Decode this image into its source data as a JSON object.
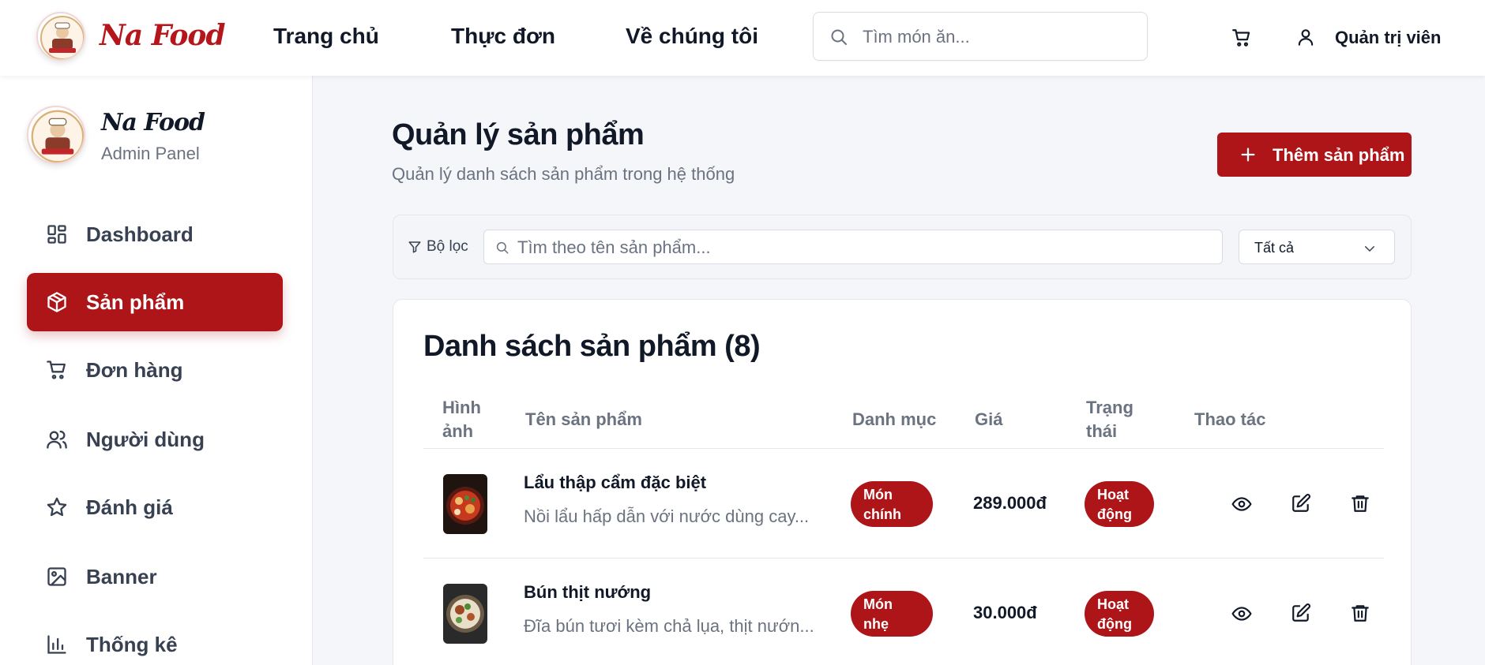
{
  "header": {
    "brand": "Na Food",
    "nav": [
      "Trang chủ",
      "Thực đơn",
      "Về chúng tôi"
    ],
    "search_placeholder": "Tìm món ăn...",
    "user_label": "Quản trị viên"
  },
  "sidebar": {
    "brand": "Na Food",
    "subtitle": "Admin Panel",
    "items": [
      {
        "label": "Dashboard",
        "icon": "dashboard-icon",
        "active": false
      },
      {
        "label": "Sản phẩm",
        "icon": "box-icon",
        "active": true
      },
      {
        "label": "Đơn hàng",
        "icon": "cart-icon",
        "active": false
      },
      {
        "label": "Người dùng",
        "icon": "users-icon",
        "active": false
      },
      {
        "label": "Đánh giá",
        "icon": "star-icon",
        "active": false
      },
      {
        "label": "Banner",
        "icon": "image-icon",
        "active": false
      },
      {
        "label": "Thống kê",
        "icon": "bar-chart-icon",
        "active": false
      }
    ]
  },
  "page": {
    "title": "Quản lý sản phẩm",
    "subtitle": "Quản lý danh sách sản phẩm trong hệ thống",
    "add_button": "Thêm sản phẩm"
  },
  "filter": {
    "label": "Bộ lọc",
    "search_placeholder": "Tìm theo tên sản phẩm...",
    "select_value": "Tất cả"
  },
  "table": {
    "title": "Danh sách sản phẩm (8)",
    "headers": {
      "image": [
        "Hình",
        "ảnh"
      ],
      "name": "Tên sản phẩm",
      "category": "Danh mục",
      "price": "Giá",
      "status": [
        "Trạng",
        "thái"
      ],
      "actions": "Thao tác"
    },
    "rows": [
      {
        "name": "Lẩu thập cẩm đặc biệt",
        "description": "Nồi lẩu hấp dẫn với nước dùng cay...",
        "category": [
          "Món",
          "chính"
        ],
        "price": "289.000đ",
        "status": [
          "Hoạt",
          "động"
        ]
      },
      {
        "name": "Bún thịt nướng",
        "description": "Đĩa bún tươi kèm chả lụa, thịt nướn...",
        "category": [
          "Món",
          "nhẹ"
        ],
        "price": "30.000đ",
        "status": [
          "Hoạt",
          "động"
        ]
      }
    ]
  },
  "colors": {
    "primary": "#ad1519",
    "background": "#f4f6f9",
    "text": "#111827",
    "muted": "#6b7280"
  }
}
